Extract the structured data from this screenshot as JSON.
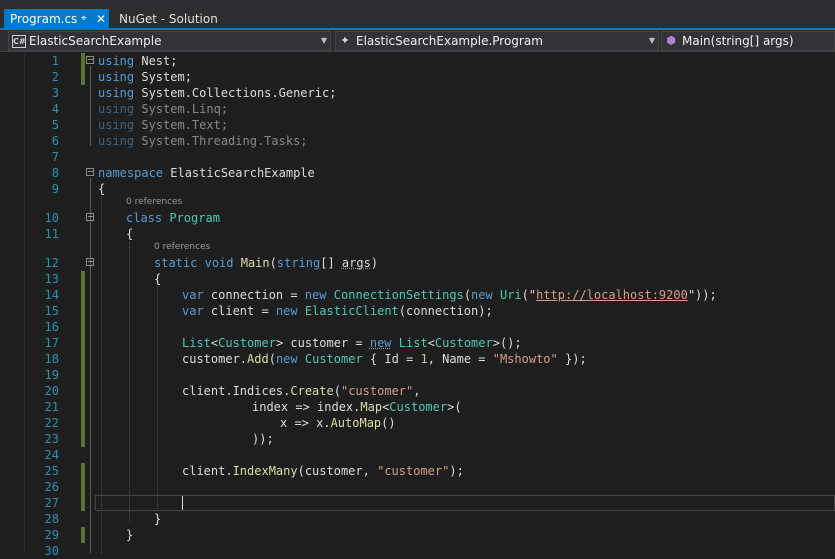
{
  "tabs": [
    {
      "label": "Program.cs",
      "active": true,
      "pin_icon": "pin-icon",
      "close_icon": "close-icon"
    },
    {
      "label": "NuGet - Solution",
      "active": false
    }
  ],
  "navbar": {
    "project": "ElasticSearchExample",
    "type": "ElasticSearchExample.Program",
    "member": "Main(string[] args)"
  },
  "code_lens": {
    "program": "0 references",
    "main": "0 references"
  },
  "lines": [
    {
      "n": "1"
    },
    {
      "n": "2"
    },
    {
      "n": "3"
    },
    {
      "n": "4"
    },
    {
      "n": "5"
    },
    {
      "n": "6"
    },
    {
      "n": "7"
    },
    {
      "n": "8"
    },
    {
      "n": "9"
    },
    {
      "n": "10"
    },
    {
      "n": "11"
    },
    {
      "n": "12"
    },
    {
      "n": "13"
    },
    {
      "n": "14"
    },
    {
      "n": "15"
    },
    {
      "n": "16"
    },
    {
      "n": "17"
    },
    {
      "n": "18"
    },
    {
      "n": "19"
    },
    {
      "n": "20"
    },
    {
      "n": "21"
    },
    {
      "n": "22"
    },
    {
      "n": "23"
    },
    {
      "n": "24"
    },
    {
      "n": "25"
    },
    {
      "n": "26"
    },
    {
      "n": "27"
    },
    {
      "n": "28"
    },
    {
      "n": "29"
    },
    {
      "n": "30"
    }
  ],
  "code": {
    "l1_kw": "using",
    "l1_rest": " Nest;",
    "l2_kw": "using",
    "l2_rest": " System;",
    "l3_kw": "using",
    "l3_rest": " System.Collections.Generic;",
    "l4_kw": "using",
    "l4_rest": " System.Linq;",
    "l5_kw": "using",
    "l5_rest": " System.Text;",
    "l6_kw": "using",
    "l6_rest": " System.Threading.Tasks;",
    "l8_kw": "namespace",
    "l8_rest": " ElasticSearchExample",
    "l9": "{",
    "l10_kw": "class",
    "l10_type": "Program",
    "l11": "{",
    "l12_kw1": "static",
    "l12_kw2": "void",
    "l12_m": "Main",
    "l12_p1": "(",
    "l12_kw3": "string",
    "l12_p2": "[] ",
    "l12_arg": "args",
    "l12_p3": ")",
    "l13": "{",
    "l14_kw": "var",
    "l14_a": " connection = ",
    "l14_new": "new",
    "l14_sp": " ",
    "l14_t": "ConnectionSettings",
    "l14_b": "(",
    "l14_new2": "new",
    "l14_sp2": " ",
    "l14_t2": "Uri",
    "l14_c": "(\"",
    "l14_url": "http://localhost:9200",
    "l14_d": "\"));",
    "l15_kw": "var",
    "l15_a": " client = ",
    "l15_new": "new",
    "l15_sp": " ",
    "l15_t": "ElasticClient",
    "l15_b": "(connection);",
    "l17_t": "List",
    "l17_a": "<",
    "l17_t2": "Customer",
    "l17_b": "> customer = ",
    "l17_new": "new",
    "l17_sp": " ",
    "l17_t3": "List",
    "l17_c": "<",
    "l17_t4": "Customer",
    "l17_d": ">();",
    "l18_a": "customer.",
    "l18_m": "Add",
    "l18_b": "(",
    "l18_new": "new",
    "l18_sp": " ",
    "l18_t": "Customer",
    "l18_c": " { Id = ",
    "l18_n": "1",
    "l18_d": ", Name = ",
    "l18_s": "\"Mshowto\"",
    "l18_e": " });",
    "l20_a": "client.Indices.",
    "l20_m": "Create",
    "l20_b": "(",
    "l20_s": "\"customer\"",
    "l20_c": ",",
    "l21_a": "index => index.",
    "l21_m": "Map",
    "l21_b": "<",
    "l21_t": "Customer",
    "l21_c": ">(",
    "l22_a": "x => x.",
    "l22_m": "AutoMap",
    "l22_b": "()",
    "l23": "));",
    "l25_a": "client.",
    "l25_m": "IndexMany",
    "l25_b": "(customer, ",
    "l25_s": "\"customer\"",
    "l25_c": ");",
    "l28": "}",
    "l29": "}"
  }
}
